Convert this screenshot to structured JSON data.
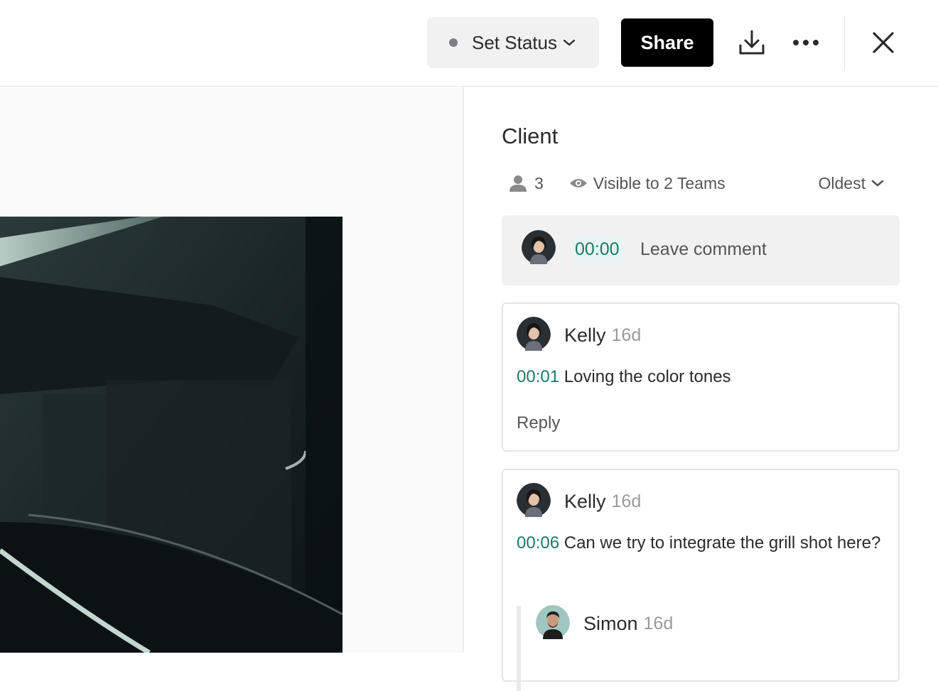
{
  "toolbar": {
    "status_label": "Set Status",
    "share_label": "Share"
  },
  "panel": {
    "title": "Client",
    "participants_count": "3",
    "visibility": "Visible to 2 Teams",
    "sort_label": "Oldest"
  },
  "compose": {
    "timecode": "00:00",
    "placeholder": "Leave comment"
  },
  "comments": [
    {
      "author": "Kelly",
      "age": "16d",
      "timecode": "00:01",
      "text": "Loving the color tones",
      "reply_label": "Reply"
    },
    {
      "author": "Kelly",
      "age": "16d",
      "timecode": "00:06",
      "text": "Can we try to integrate the grill shot here?",
      "replies": [
        {
          "author": "Simon",
          "age": "16d"
        }
      ]
    }
  ],
  "colors": {
    "accent_timecode": "#1b7a6a",
    "share_bg": "#000000",
    "status_dot": "#7c7f86"
  }
}
